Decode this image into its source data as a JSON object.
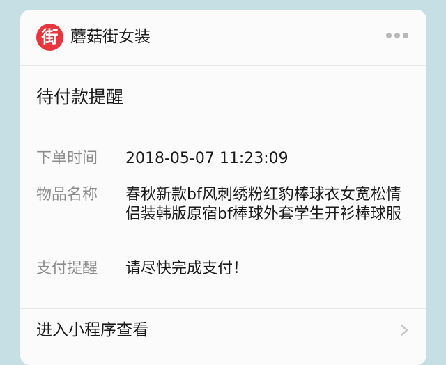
{
  "header": {
    "logo_char": "街",
    "app_name": "蘑菇街女装",
    "more_icon": "more-dots-icon"
  },
  "title": "待付款提醒",
  "fields": [
    {
      "label": "下单时间",
      "value": "2018-05-07 11:23:09"
    },
    {
      "label": "物品名称",
      "value": "春秋新款bf风刺绣粉红豹棒球衣女宽松情侣装韩版原宿bf棒球外套学生开衫棒球服"
    },
    {
      "label": "支付提醒",
      "value": "请尽快完成支付！"
    }
  ],
  "footer": {
    "label": "进入小程序查看",
    "icon": "chevron-right-icon"
  },
  "colors": {
    "background": "#c6dfe5",
    "card": "#fbfbfc",
    "brand_red": "#e8363f",
    "label_gray": "#8c8c8c",
    "text": "#1a1a1a"
  }
}
